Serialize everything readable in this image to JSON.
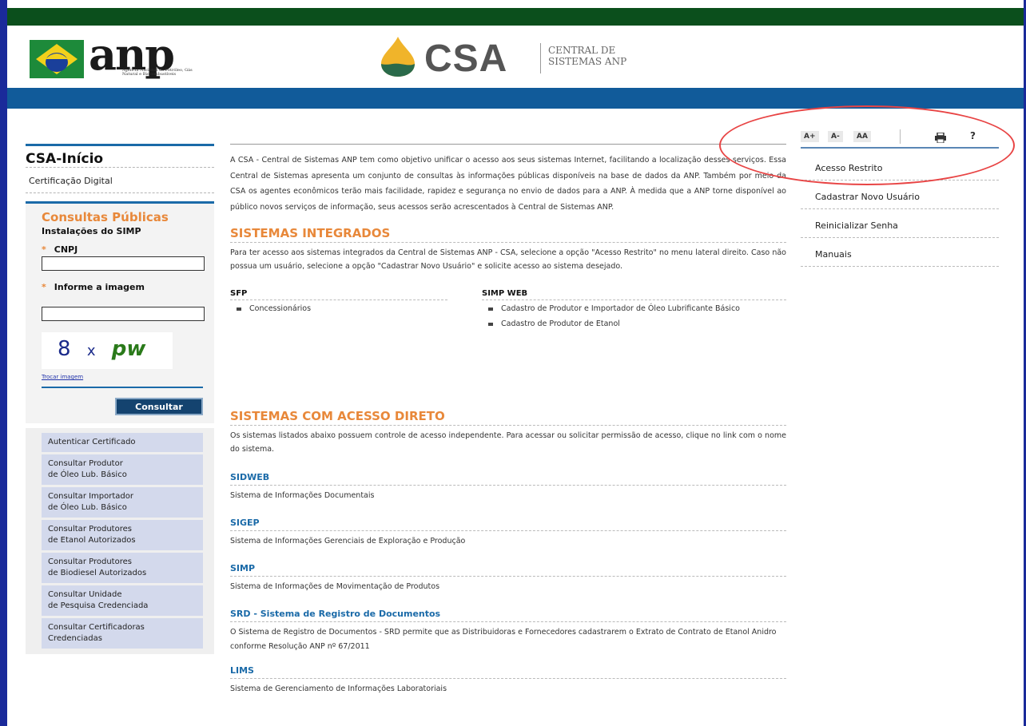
{
  "header": {
    "anp_logo_text": "anp",
    "anp_subtitle": "Agência Nacional do Petróleo, Gás Natural e Biocombustíveis",
    "csa_logo_text": "CSA",
    "csa_subtitle_line1": "CENTRAL DE",
    "csa_subtitle_line2": "SISTEMAS ANP"
  },
  "left": {
    "title": "CSA-Início",
    "cert_digital": "Certificação Digital",
    "consultas_title": "Consultas Públicas",
    "simp_title": "Instalações do SIMP",
    "cnpj_label": "CNPJ",
    "image_label": "Informe a imagem",
    "captcha_text_1": "8",
    "captcha_text_2": "x",
    "captcha_text_3": "pw",
    "trocar_imagem": "Trocar imagem",
    "consultar_button": "Consultar",
    "menu": [
      {
        "line1": "Autenticar Certificado",
        "line2": ""
      },
      {
        "line1": "Consultar Produtor",
        "line2": "de Óleo Lub. Básico"
      },
      {
        "line1": "Consultar Importador",
        "line2": "de Óleo Lub. Básico"
      },
      {
        "line1": "Consultar Produtores",
        "line2": "de Etanol Autorizados"
      },
      {
        "line1": "Consultar Produtores",
        "line2": "de Biodiesel Autorizados"
      },
      {
        "line1": "Consultar Unidade",
        "line2": "de Pesquisa Credenciada"
      },
      {
        "line1": "Consultar Certificadoras",
        "line2": "Credenciadas"
      }
    ]
  },
  "main": {
    "intro": "A CSA - Central de Sistemas ANP tem como objetivo unificar o acesso aos seus sistemas Internet, facilitando a localização desses serviços. Essa Central de Sistemas apresenta um conjunto de consultas às informações públicas disponíveis na base de dados da ANP. Também por meio da CSA os agentes econômicos terão mais facilidade, rapidez e segurança no envio de dados para a ANP. À medida que a ANP torne disponível ao público novos serviços de informação, seus acessos serão acrescentados à Central de Sistemas ANP.",
    "integrados_title": "SISTEMAS INTEGRADOS",
    "integrados_text": "Para ter acesso aos sistemas integrados da Central de Sistemas ANP - CSA, selecione a opção \"Acesso Restrito\" no menu lateral direito. Caso não possua um usuário, selecione a opção \"Cadastrar Novo Usuário\" e solicite acesso ao sistema desejado.",
    "sfp_head": "SFP",
    "sfp_items": [
      "Concessionários"
    ],
    "simpweb_head": "SIMP WEB",
    "simpweb_items": [
      "Cadastro de Produtor e Importador de Óleo Lubrificante Básico",
      "Cadastro de Produtor de Etanol"
    ],
    "direto_title": "SISTEMAS COM ACESSO DIRETO",
    "direto_text": "Os sistemas listados abaixo possuem controle de acesso independente. Para acessar ou solicitar permissão de acesso, clique no link com o nome do sistema.",
    "systems": [
      {
        "name": "SIDWEB",
        "desc": "Sistema de Informações Documentais"
      },
      {
        "name": "SIGEP",
        "desc": "Sistema de Informações Gerenciais de Exploração e Produção"
      },
      {
        "name": "SIMP",
        "desc": "Sistema de Informações de Movimentação de Produtos"
      },
      {
        "name": "SRD - Sistema de Registro de Documentos",
        "desc": "O Sistema de Registro de Documentos - SRD permite que as Distribuidoras e Fornecedores cadastrarem o Extrato de Contrato de Etanol Anidro conforme Resolução ANP nº 67/2011"
      },
      {
        "name": "LIMS",
        "desc": "Sistema de Gerenciamento de Informações Laboratoriais"
      }
    ]
  },
  "right": {
    "font_increase": "A+",
    "font_decrease": "A-",
    "font_reset": "AA",
    "help": "?",
    "links": [
      "Acesso Restrito",
      "Cadastrar Novo Usuário",
      "Reinicializar Senha",
      "Manuais"
    ]
  },
  "colors": {
    "top_bar": "#0b4f1c",
    "blue_band": "#115b9a",
    "accent_orange": "#e8883a",
    "link_blue": "#1a6aa8",
    "highlight_red": "#e84444"
  }
}
